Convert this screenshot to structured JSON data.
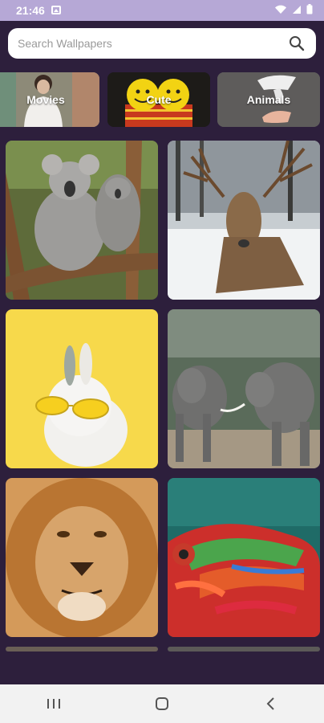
{
  "status_bar": {
    "time": "21:46",
    "icons": [
      "image-icon",
      "wifi-icon",
      "signal-icon",
      "battery-icon"
    ]
  },
  "search": {
    "placeholder": "Search Wallpapers",
    "value": ""
  },
  "categories": [
    {
      "label": "Movies"
    },
    {
      "label": "Cute"
    },
    {
      "label": "Animals"
    }
  ],
  "wallpapers": [
    {
      "subject": "koalas"
    },
    {
      "subject": "deer"
    },
    {
      "subject": "rabbit"
    },
    {
      "subject": "elephants"
    },
    {
      "subject": "lion"
    },
    {
      "subject": "chameleon"
    }
  ],
  "nav_bar": {
    "buttons": [
      "recent-apps-icon",
      "home-icon",
      "back-icon"
    ]
  },
  "colors": {
    "background": "#2d1f3c",
    "status_bar": "#b6a8d6",
    "search_bg": "#ffffff",
    "nav_bar": "#f2f2f2"
  }
}
